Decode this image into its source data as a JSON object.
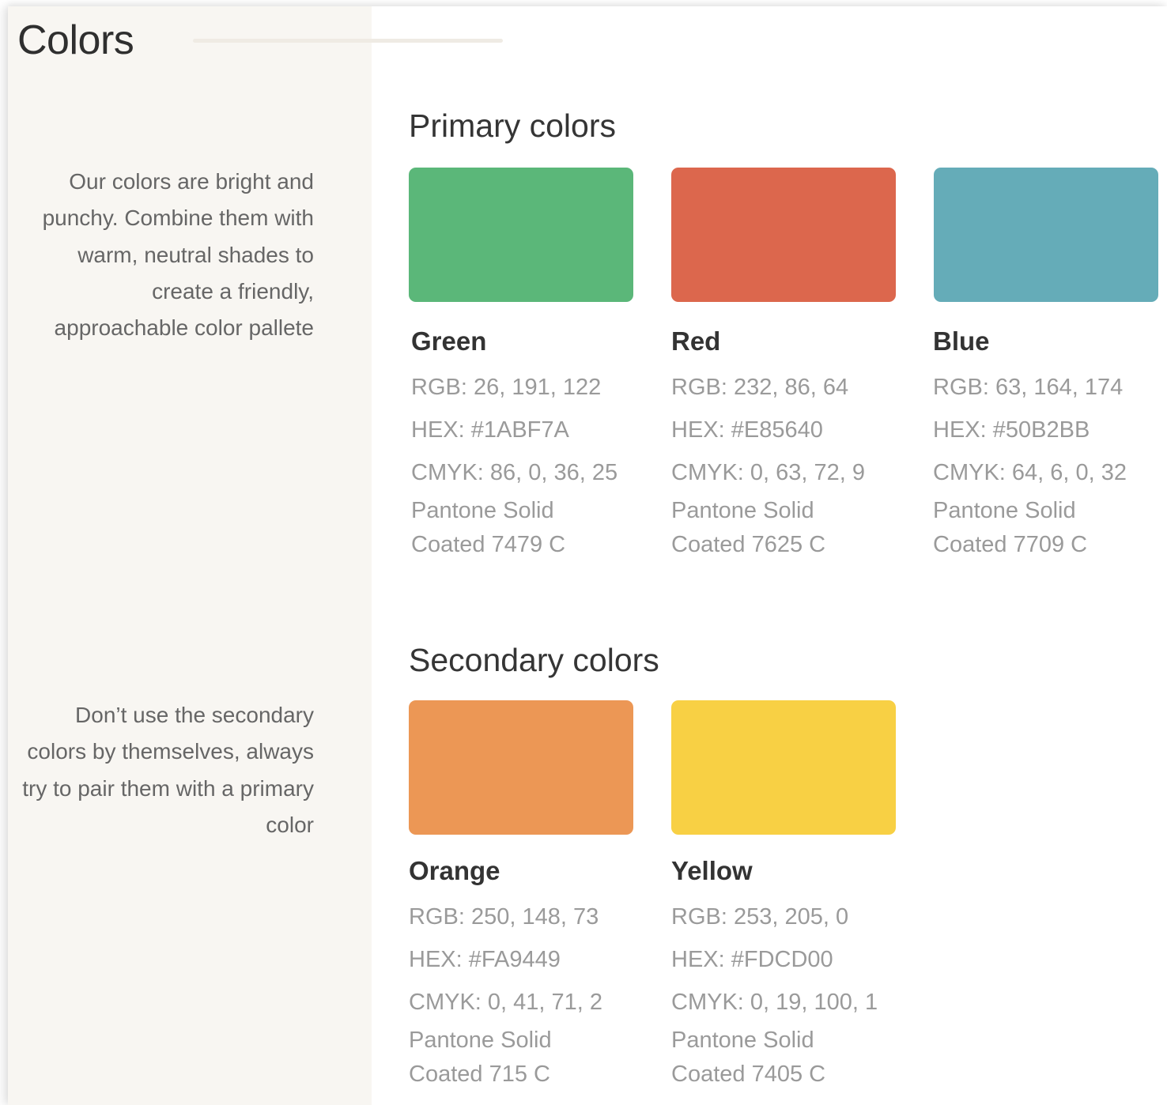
{
  "page": {
    "title": "Colors"
  },
  "sections": {
    "primary": {
      "heading": "Primary colors",
      "description": "Our colors are bright and punchy. Combine them with warm, neutral shades to create a friendly, approachable color pallete",
      "colors": [
        {
          "name": "Green",
          "swatch_color": "#5bb779",
          "rgb": "RGB: 26, 191, 122",
          "hex": "HEX: #1ABF7A",
          "cmyk": "CMYK: 86, 0, 36, 25",
          "pantone_line1": "Pantone Solid",
          "pantone_line2": "Coated 7479 C"
        },
        {
          "name": "Red",
          "swatch_color": "#dc674d",
          "rgb": "RGB: 232, 86, 64",
          "hex": "HEX: #E85640",
          "cmyk": "CMYK: 0, 63, 72, 9",
          "pantone_line1": "Pantone Solid",
          "pantone_line2": "Coated 7625 C"
        },
        {
          "name": "Blue",
          "swatch_color": "#65acb8",
          "rgb": "RGB: 63, 164, 174",
          "hex": "HEX: #50B2BB",
          "cmyk": "CMYK: 64, 6, 0, 32",
          "pantone_line1": "Pantone Solid",
          "pantone_line2": "Coated 7709 C"
        }
      ]
    },
    "secondary": {
      "heading": "Secondary colors",
      "description": "Don’t use the secondary colors by themselves, always try to pair them with a primary color",
      "colors": [
        {
          "name": "Orange",
          "swatch_color": "#ec9755",
          "rgb": "RGB: 250, 148, 73",
          "hex": "HEX: #FA9449",
          "cmyk": "CMYK: 0, 41, 71, 2",
          "pantone_line1": "Pantone Solid",
          "pantone_line2": "Coated 715 C"
        },
        {
          "name": "Yellow",
          "swatch_color": "#f8d044",
          "rgb": "RGB: 253, 205, 0",
          "hex": "HEX: #FDCD00",
          "cmyk": "CMYK: 0, 19, 100, 1",
          "pantone_line1": "Pantone Solid",
          "pantone_line2": "Coated 7405 C"
        }
      ]
    }
  }
}
